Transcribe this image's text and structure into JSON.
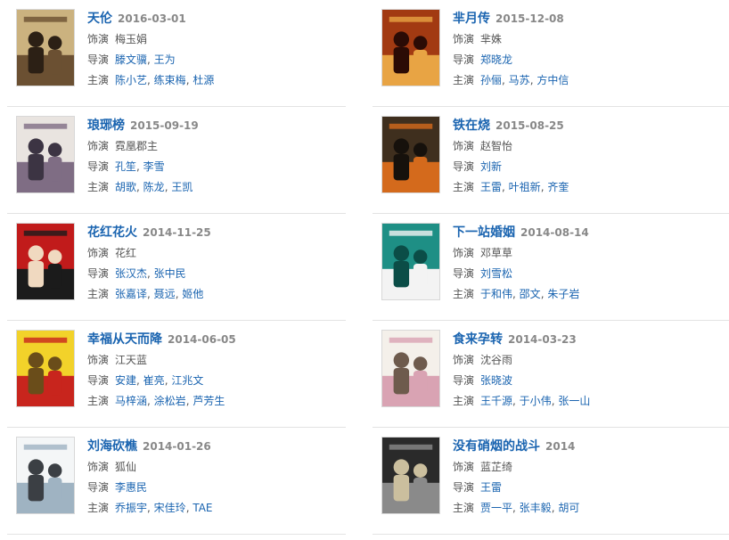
{
  "labels": {
    "role": "饰演",
    "director": "导演",
    "cast": "主演"
  },
  "items": [
    {
      "title": "天伦",
      "date": "2016-03-01",
      "role": "梅玉娟",
      "directors": [
        "滕文骥",
        "王为"
      ],
      "cast": [
        "陈小艺",
        "练束梅",
        "杜源"
      ],
      "poster_colors": [
        "#cbb27f",
        "#6b5032",
        "#2c2015"
      ]
    },
    {
      "title": "芈月传",
      "date": "2015-12-08",
      "role": "芈姝",
      "directors": [
        "郑晓龙"
      ],
      "cast": [
        "孙俪",
        "马苏",
        "方中信"
      ],
      "poster_colors": [
        "#a23a12",
        "#e8a444",
        "#2b0b05"
      ]
    },
    {
      "title": "琅琊榜",
      "date": "2015-09-19",
      "role": "霓凰郡主",
      "directors": [
        "孔笙",
        "李雪"
      ],
      "cast": [
        "胡歌",
        "陈龙",
        "王凯"
      ],
      "poster_colors": [
        "#e9e4e0",
        "#7f6d84",
        "#3c3443"
      ]
    },
    {
      "title": "铁在烧",
      "date": "2015-08-25",
      "role": "赵智怡",
      "directors": [
        "刘新"
      ],
      "cast": [
        "王雷",
        "叶祖新",
        "齐奎"
      ],
      "poster_colors": [
        "#3f2f1e",
        "#d46a1c",
        "#16110c"
      ]
    },
    {
      "title": "花红花火",
      "date": "2014-11-25",
      "role": "花红",
      "directors": [
        "张汉杰",
        "张中民"
      ],
      "cast": [
        "张嘉译",
        "聂远",
        "姬他"
      ],
      "poster_colors": [
        "#c11b1b",
        "#1b1b1b",
        "#f0d9c0"
      ]
    },
    {
      "title": "下一站婚姻",
      "date": "2014-08-14",
      "role": "邓草草",
      "directors": [
        "刘雪松"
      ],
      "cast": [
        "于和伟",
        "邵文",
        "朱子岩"
      ],
      "poster_colors": [
        "#1e8f85",
        "#f3f3f3",
        "#0b4d47"
      ]
    },
    {
      "title": "幸福从天而降",
      "date": "2014-06-05",
      "role": "江天蓝",
      "directors": [
        "安建",
        "崔亮",
        "江兆文"
      ],
      "cast": [
        "马梓涵",
        "涂松岩",
        "芦芳生"
      ],
      "poster_colors": [
        "#f2d22a",
        "#c8251d",
        "#6a4d1a"
      ]
    },
    {
      "title": "食来孕转",
      "date": "2014-03-23",
      "role": "沈谷雨",
      "directors": [
        "张晓波"
      ],
      "cast": [
        "王千源",
        "于小伟",
        "张一山"
      ],
      "poster_colors": [
        "#f4f0ea",
        "#d9a3b3",
        "#6e5b4d"
      ]
    },
    {
      "title": "刘海砍樵",
      "date": "2014-01-26",
      "role": "狐仙",
      "directors": [
        "李惠民"
      ],
      "cast": [
        "乔振宇",
        "宋佳玲",
        "TAE"
      ],
      "poster_colors": [
        "#f4f6f7",
        "#9fb3c2",
        "#3b3f44"
      ]
    },
    {
      "title": "没有硝烟的战斗",
      "date": "2014",
      "role": "蓝芷绮",
      "directors": [
        "王雷"
      ],
      "cast": [
        "贾一平",
        "张丰毅",
        "胡可"
      ],
      "poster_colors": [
        "#2a2a2a",
        "#8a8a8a",
        "#cbbf9e"
      ]
    }
  ]
}
